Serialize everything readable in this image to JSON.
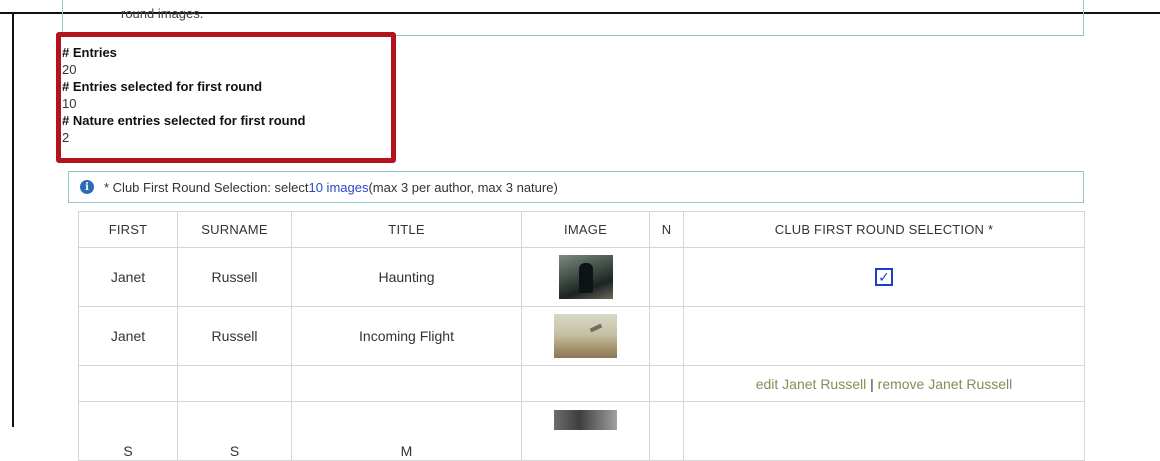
{
  "top_box": {
    "text": "round images."
  },
  "stats": {
    "entries_label": "# Entries",
    "entries_value": "20",
    "selected_label": "# Entries selected for first round",
    "selected_value": "10",
    "nature_label": "# Nature entries selected for first round",
    "nature_value": "2"
  },
  "notice": {
    "prefix": "* Club First Round Selection: select ",
    "link": "10 images",
    "suffix": " (max 3 per author, max 3 nature)"
  },
  "table": {
    "headers": [
      "FIRST",
      "SURNAME",
      "TITLE",
      "IMAGE",
      "N",
      "CLUB FIRST ROUND SELECTION *"
    ],
    "rows": [
      {
        "first": "Janet",
        "surname": "Russell",
        "title": "Haunting",
        "checked_glyph": "✓"
      },
      {
        "first": "Janet",
        "surname": "Russell",
        "title": "Incoming Flight"
      }
    ],
    "actions": {
      "edit": "edit Janet Russell",
      "separator": "|",
      "remove": "remove Janet Russell"
    },
    "partial_row": {
      "first": "S",
      "surname": "S",
      "title": "M"
    }
  },
  "colors": {
    "highlight": "#b3141c",
    "link": "#2a48c8",
    "action_link": "#8b8a5a",
    "box_border": "#8ec9c3"
  }
}
